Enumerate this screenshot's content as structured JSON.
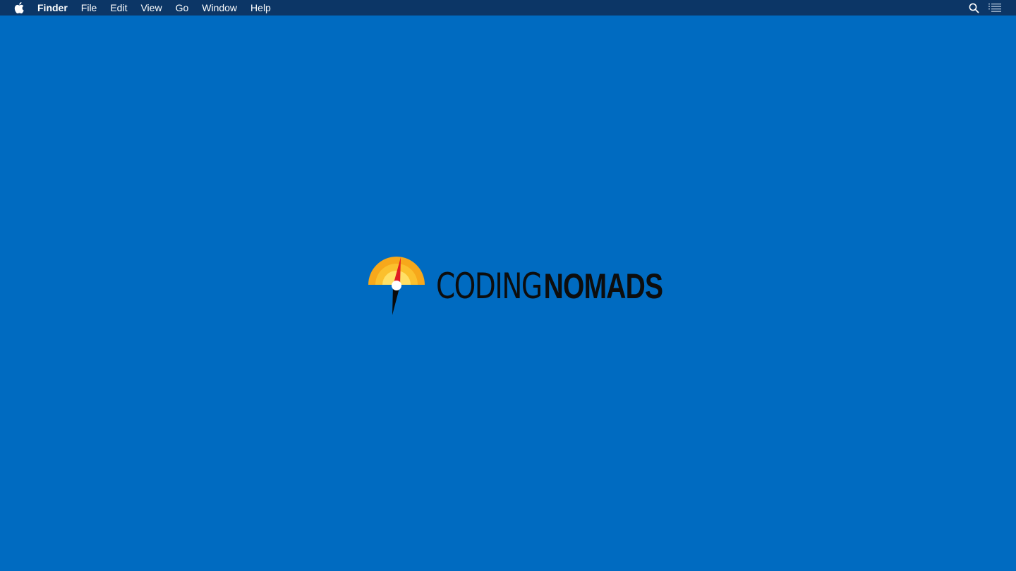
{
  "menubar": {
    "apple_icon": "apple-logo-icon",
    "app_name": "Finder",
    "items": [
      {
        "label": "File"
      },
      {
        "label": "Edit"
      },
      {
        "label": "View"
      },
      {
        "label": "Go"
      },
      {
        "label": "Window"
      },
      {
        "label": "Help"
      }
    ],
    "right_icons": [
      "search-icon",
      "list-icon"
    ],
    "background_color": "#0c3666"
  },
  "desktop": {
    "background_color": "#006bc1",
    "logo": {
      "word_light": "CODING",
      "word_bold": "NOMADS",
      "mark_icon": "compass-sunrise-icon",
      "colors": {
        "outer_arc": "#f7a81b",
        "mid_arc": "#fbc02d",
        "inner_arc": "#ffe066",
        "needle_north": "#e11b22",
        "needle_south": "#0a0a0a",
        "pivot": "#ffffff",
        "text": "#0d0d0d"
      }
    }
  }
}
